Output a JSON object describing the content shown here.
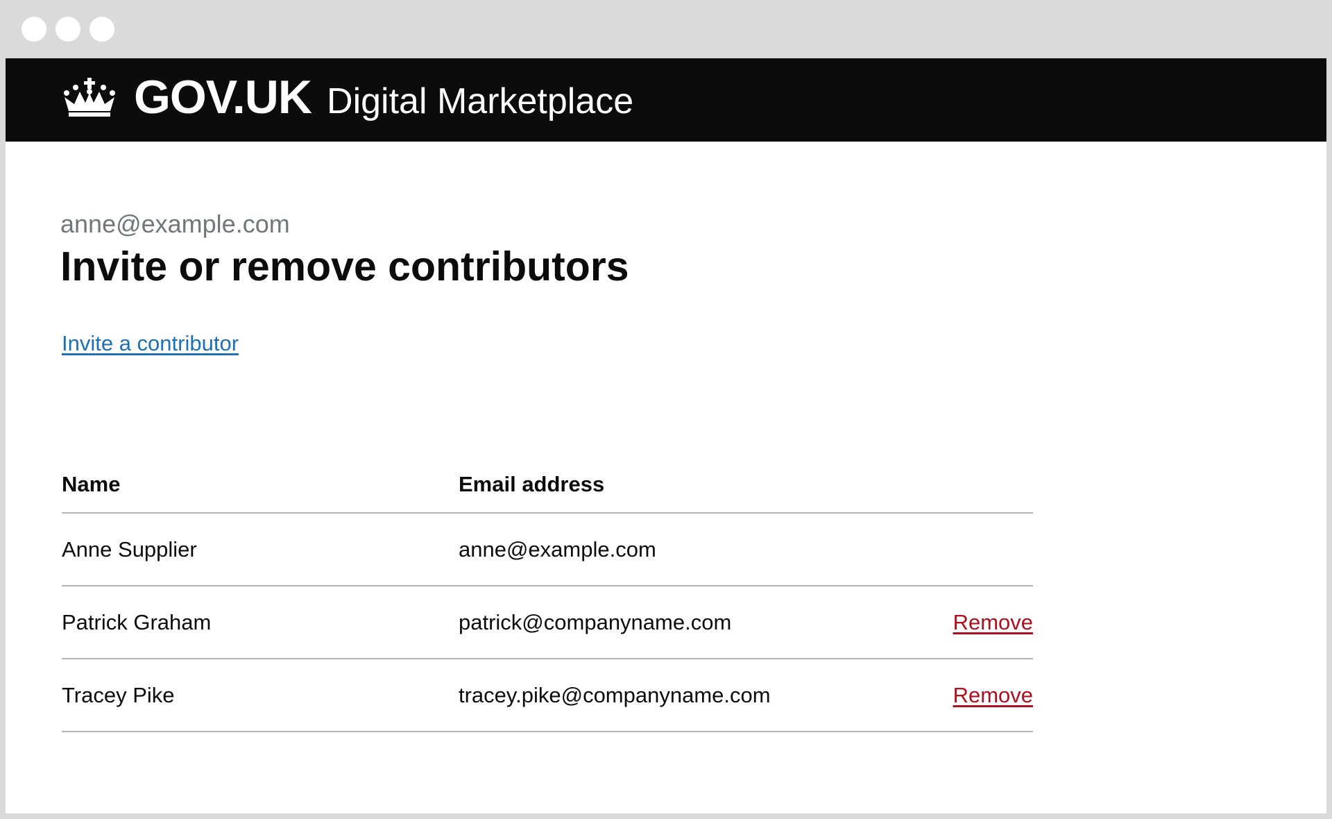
{
  "browser": {
    "window_controls": [
      "dot",
      "dot",
      "dot"
    ]
  },
  "header": {
    "logo_icon": "crown-icon",
    "brand": "GOV.UK",
    "service_name": "Digital Marketplace"
  },
  "page": {
    "caption": "anne@example.com",
    "title": "Invite or remove contributors",
    "invite_link": "Invite a contributor"
  },
  "contributors_table": {
    "columns": [
      "Name",
      "Email address"
    ],
    "rows": [
      {
        "name": "Anne Supplier",
        "email": "anne@example.com",
        "action": ""
      },
      {
        "name": "Patrick Graham",
        "email": "patrick@companyname.com",
        "action": "Remove"
      },
      {
        "name": "Tracey Pike",
        "email": "tracey.pike@companyname.com",
        "action": "Remove"
      }
    ]
  },
  "colors": {
    "header_bg": "#0b0c0c",
    "link": "#1d70b8",
    "remove_link": "#b10e1e",
    "caption": "#6f777b",
    "divider": "#b1b4b6"
  }
}
